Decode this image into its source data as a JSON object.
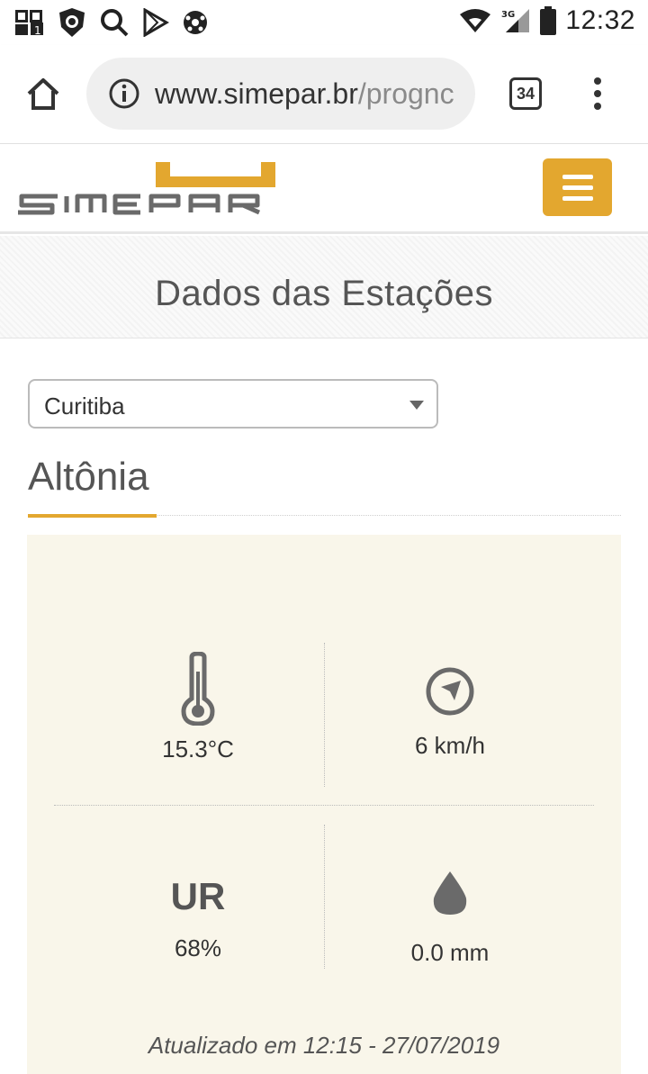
{
  "status_bar": {
    "time": "12:32",
    "network_label": "3G",
    "icons": [
      "sim-card-icon",
      "shield-icon",
      "search-icon",
      "play-store-icon",
      "soccer-ball-icon",
      "wifi-icon",
      "signal-icon",
      "battery-icon"
    ]
  },
  "browser": {
    "url_host": "www.simepar.br",
    "url_path": "/prognc",
    "tab_count": "34",
    "icons": [
      "home-icon",
      "info-icon",
      "overflow-menu-icon"
    ]
  },
  "site": {
    "logo_text": "SIMEPAR",
    "accent_color": "#e3a72f"
  },
  "page": {
    "title": "Dados das Estações"
  },
  "city_select": {
    "value": "Curitiba"
  },
  "station": {
    "name": "Altônia"
  },
  "readings": {
    "temperature": "15.3°C",
    "wind": "6 km/h",
    "humidity_label": "UR",
    "humidity": "68%",
    "rain": "0.0 mm",
    "updated": "Atualizado em 12:15 - 27/07/2019"
  }
}
